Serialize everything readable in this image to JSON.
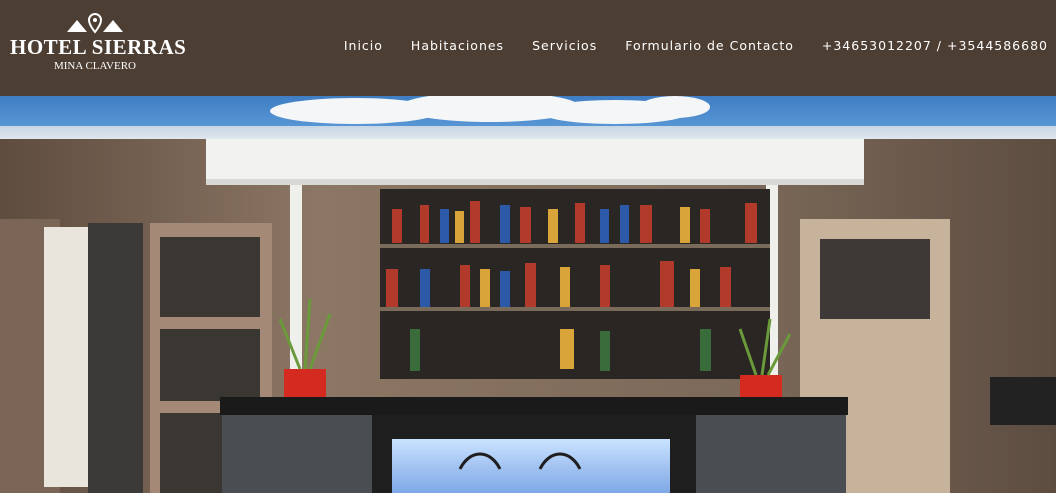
{
  "logo": {
    "title": "HOTEL SIERRAS",
    "subtitle": "MINA CLAVERO",
    "icon": "mountain-pin-icon"
  },
  "nav": {
    "items": [
      {
        "label": "Inicio"
      },
      {
        "label": "Habitaciones"
      },
      {
        "label": "Servicios"
      },
      {
        "label": "Formulario de Contacto"
      },
      {
        "label": "+34653012207 / +3544586680"
      }
    ]
  },
  "colors": {
    "header_bg": "#4d3e34",
    "nav_text": "#ffffff",
    "sky": "#4a8ad0"
  },
  "hero": {
    "subject": "hotel bar counter with bottle shelves"
  }
}
